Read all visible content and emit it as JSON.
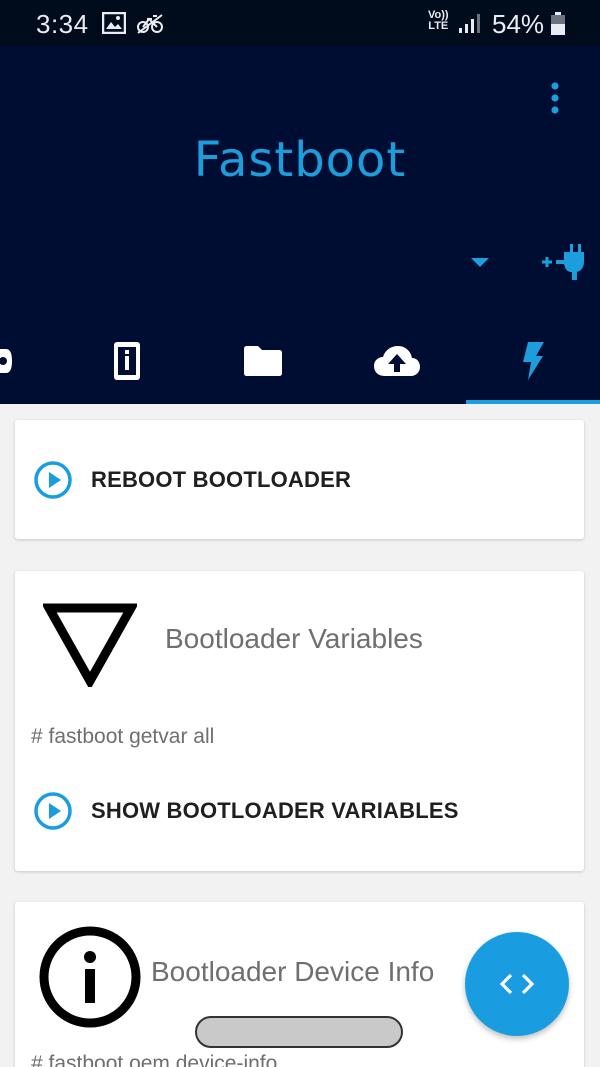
{
  "status_bar": {
    "time": "3:34",
    "volte_top": "Vo))",
    "volte_bottom": "LTE",
    "battery": "54%"
  },
  "header": {
    "title": "Fastboot",
    "accent_color": "#1c9ddc",
    "background_color": "#000d33"
  },
  "tabs": [
    {
      "icon": "device-icon",
      "active": false
    },
    {
      "icon": "phone-info-icon",
      "active": false
    },
    {
      "icon": "folder-icon",
      "active": false
    },
    {
      "icon": "cloud-upload-icon",
      "active": false
    },
    {
      "icon": "flash-icon",
      "active": true
    }
  ],
  "cards": {
    "reboot": {
      "action_label": "REBOOT BOOTLOADER"
    },
    "variables": {
      "title": "Bootloader Variables",
      "command": "# fastboot getvar all",
      "action_label": "SHOW BOOTLOADER VARIABLES"
    },
    "device_info": {
      "title": "Bootloader Device Info",
      "command": "# fastboot oem device-info"
    }
  }
}
